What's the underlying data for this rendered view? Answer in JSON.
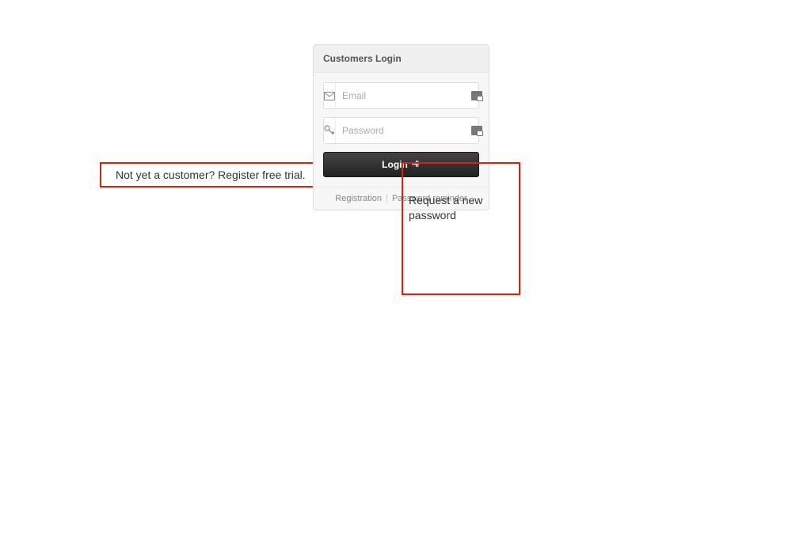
{
  "panel": {
    "title": "Customers Login",
    "email_placeholder": "Email",
    "password_placeholder": "Password",
    "login_label": "Login",
    "footer": {
      "registration": "Registration",
      "separator": "|",
      "reminder": "Password reminder"
    }
  },
  "callouts": {
    "left": "Not yet a customer? Register free trial.",
    "right": "Request a new password"
  },
  "colors": {
    "callout_border": "#d9230f"
  }
}
